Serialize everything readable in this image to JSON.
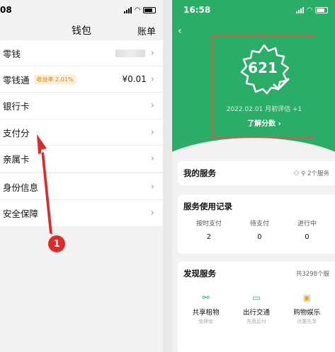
{
  "left": {
    "status_time": "08",
    "title": "钱包",
    "bill_link": "账单",
    "group1": [
      {
        "label": "零钱"
      },
      {
        "label": "零钱通",
        "badge": "收益率 2.01%",
        "value": "¥0.01"
      },
      {
        "label": "银行卡"
      }
    ],
    "group2": [
      {
        "label": "支付分"
      },
      {
        "label": "亲属卡"
      },
      {
        "label": "身份信息"
      },
      {
        "label": "安全保障"
      }
    ],
    "annotation_number": "1"
  },
  "right": {
    "status_time": "16:58",
    "score": "621",
    "eval_text": "2022.02.01 月初评估 +1",
    "learn_link": "了解分数 ›",
    "my_services": {
      "title": "我的服务",
      "count": "2个服务"
    },
    "usage": {
      "title": "服务使用记录",
      "stats": [
        {
          "label": "按时支付",
          "value": "2"
        },
        {
          "label": "待支付",
          "value": "0"
        },
        {
          "label": "进行中",
          "value": "0"
        }
      ]
    },
    "discover": {
      "title": "发现服务",
      "count": "共3298个服",
      "items": [
        {
          "icon": "share-icon",
          "title": "共享租物",
          "sub": "免押金"
        },
        {
          "icon": "bus-icon",
          "title": "出行交通",
          "sub": "先用后付"
        },
        {
          "icon": "shopping-icon",
          "title": "购物娱乐",
          "sub": "优惠先享"
        }
      ]
    }
  },
  "colors": {
    "brand_green": "#2aae67",
    "annotation_red": "#e02a2a"
  }
}
